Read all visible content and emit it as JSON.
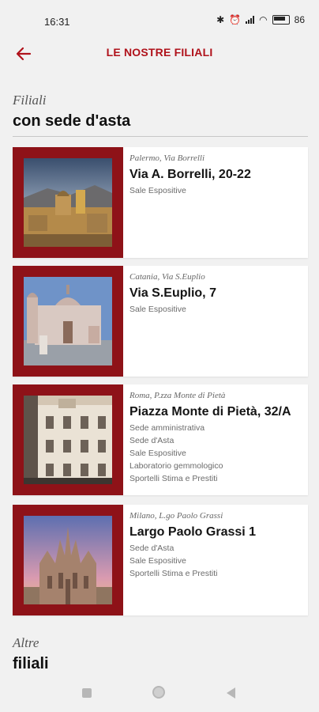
{
  "status_bar": {
    "time": "16:31",
    "battery": "86"
  },
  "header": {
    "title": "LE NOSTRE FILIALI",
    "back_icon": "arrow-left-icon"
  },
  "section_auction": {
    "subtitle": "Filiali",
    "title": "con sede d'asta"
  },
  "branches": [
    {
      "location": "Palermo, Via Borrelli",
      "address": "Via A. Borrelli, 20-22",
      "services": [
        "Sale Espositive"
      ]
    },
    {
      "location": "Catania, Via S.Euplio",
      "address": "Via S.Euplio, 7",
      "services": [
        "Sale Espositive"
      ]
    },
    {
      "location": "Roma, P.zza Monte di Pietà",
      "address": "Piazza Monte di Pietà, 32/A",
      "services": [
        "Sede amministrativa",
        "Sede d'Asta",
        "Sale Espositive",
        "Laboratorio gemmologico",
        "Sportelli Stima e Prestiti"
      ]
    },
    {
      "location": "Milano, L.go Paolo Grassi",
      "address": "Largo Paolo Grassi 1",
      "services": [
        "Sede d'Asta",
        "Sale Espositive",
        "Sportelli Stima e Prestiti"
      ]
    }
  ],
  "section_other": {
    "subtitle": "Altre",
    "title": "filiali"
  },
  "colors": {
    "accent": "#b0121b",
    "frame": "#8e1218",
    "background": "#f1f1f1"
  }
}
